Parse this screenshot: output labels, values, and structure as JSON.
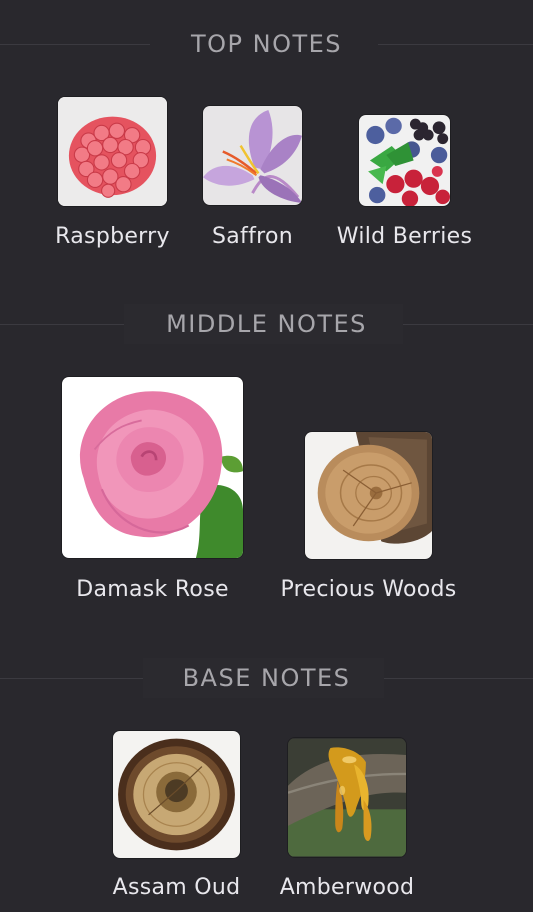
{
  "sections": [
    {
      "title": "TOP NOTES",
      "notes": [
        {
          "label": "Raspberry",
          "image": "raspberry-image"
        },
        {
          "label": "Saffron",
          "image": "saffron-image"
        },
        {
          "label": "Wild Berries",
          "image": "wild-berries-image"
        }
      ]
    },
    {
      "title": "MIDDLE NOTES",
      "notes": [
        {
          "label": "Damask Rose",
          "image": "rose-image"
        },
        {
          "label": "Precious Woods",
          "image": "wood-log-image"
        }
      ]
    },
    {
      "title": "BASE NOTES",
      "notes": [
        {
          "label": "Assam Oud",
          "image": "oud-wood-slice-image"
        },
        {
          "label": "Amberwood",
          "image": "amber-resin-image"
        }
      ]
    }
  ],
  "colors": {
    "background": "#29282d",
    "header_text": "#a7a6ab",
    "label_text": "#e8e7ec",
    "divider": "#3b3a40"
  }
}
